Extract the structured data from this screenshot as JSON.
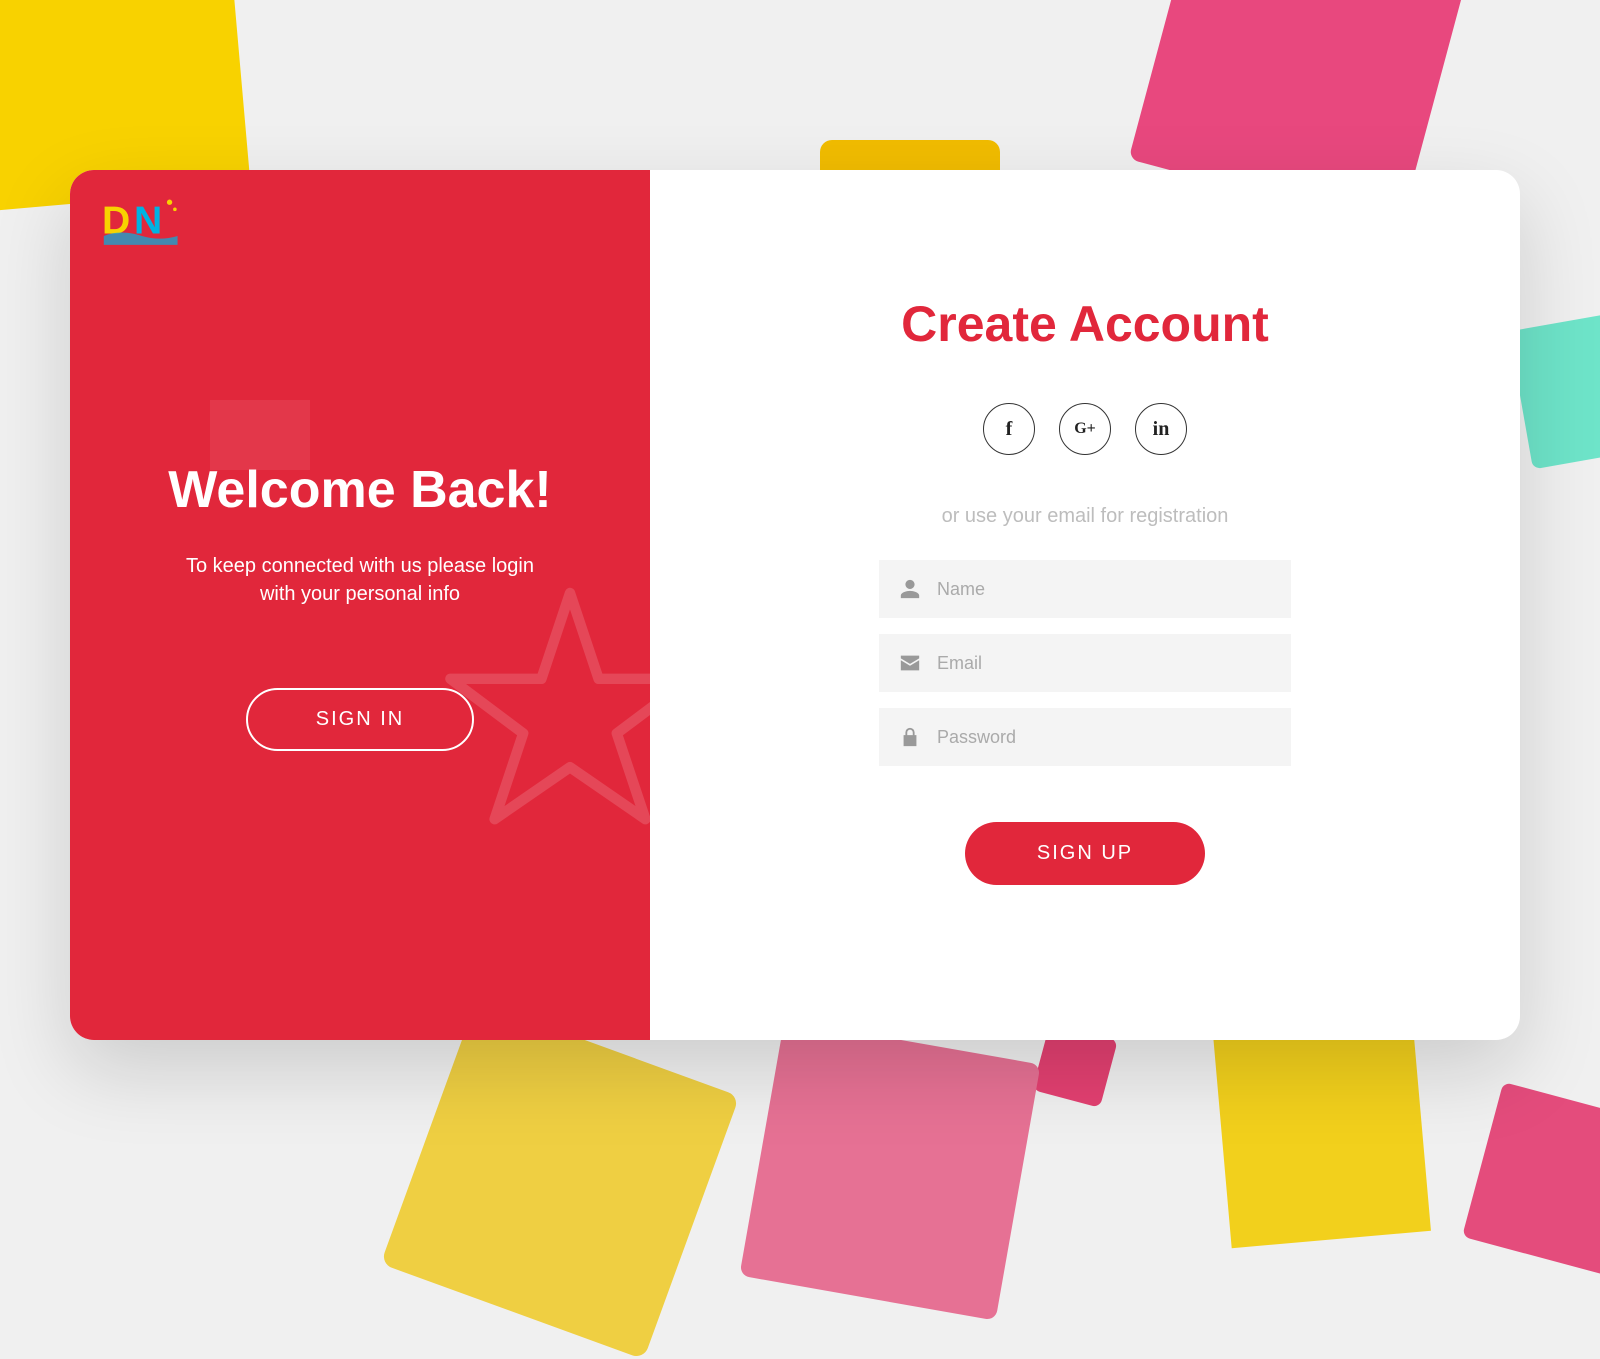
{
  "colors": {
    "accent": "#e1273b",
    "yellow": "#f8d200",
    "pink": "#e8487e",
    "teal": "#6ee4c9"
  },
  "logo": {
    "text": "DN"
  },
  "left": {
    "title": "Welcome Back!",
    "subtitle": "To keep connected with us please login with your personal info",
    "signin_label": "SIGN IN"
  },
  "right": {
    "title": "Create Account",
    "or_text": "or use your email for registration",
    "social": {
      "facebook": "f",
      "google": "G+",
      "linkedin": "in"
    },
    "inputs": {
      "name_placeholder": "Name",
      "email_placeholder": "Email",
      "password_placeholder": "Password"
    },
    "signup_label": "SIGN UP"
  }
}
